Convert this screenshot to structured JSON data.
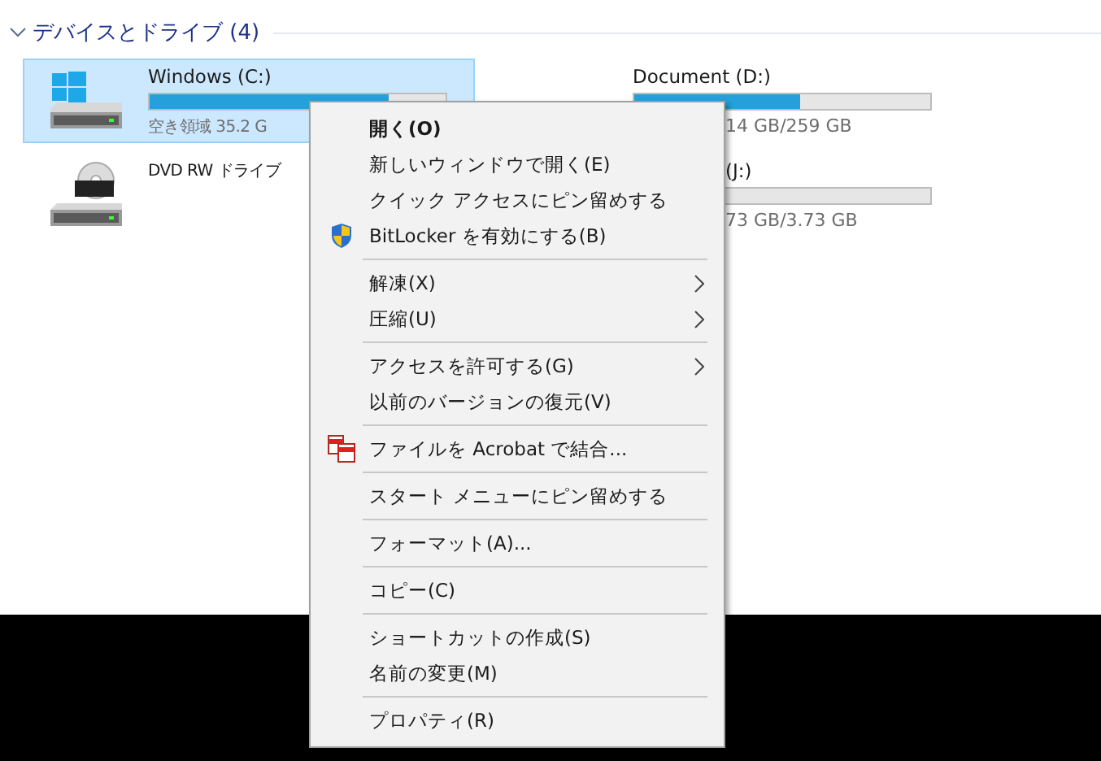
{
  "section": {
    "title": "デバイスとドライブ (4)",
    "expanded": true
  },
  "drives": [
    {
      "kind": "windows",
      "label": "Windows (C:)",
      "detail": "空き領域 35.2 G",
      "level": 0.81,
      "selected": true
    },
    {
      "kind": "plain",
      "label": "Document (D:)",
      "detail": "14 GB/259 GB",
      "level": 0.56,
      "selected": false
    },
    {
      "kind": "dvd",
      "label": "DVD RW ドライブ",
      "selected": false
    },
    {
      "kind": "covered",
      "label": "(J:)",
      "detail": "73 GB/3.73 GB",
      "selected": false
    }
  ],
  "context_menu": [
    {
      "kind": "item",
      "label": "開く(O)",
      "default": true
    },
    {
      "kind": "item",
      "label": "新しいウィンドウで開く(E)"
    },
    {
      "kind": "item",
      "label": "クイック アクセスにピン留めする"
    },
    {
      "kind": "shield",
      "label": "BitLocker を有効にする(B)"
    },
    {
      "kind": "separator"
    },
    {
      "kind": "item",
      "label": "解凍(X)",
      "submenu": true
    },
    {
      "kind": "item",
      "label": "圧縮(U)",
      "submenu": true
    },
    {
      "kind": "separator"
    },
    {
      "kind": "item",
      "label": "アクセスを許可する(G)",
      "submenu": true
    },
    {
      "kind": "item",
      "label": "以前のバージョンの復元(V)"
    },
    {
      "kind": "separator"
    },
    {
      "kind": "acrobat",
      "label": "ファイルを Acrobat で結合..."
    },
    {
      "kind": "separator"
    },
    {
      "kind": "item",
      "label": "スタート メニューにピン留めする"
    },
    {
      "kind": "separator"
    },
    {
      "kind": "item",
      "label": "フォーマット(A)..."
    },
    {
      "kind": "separator"
    },
    {
      "kind": "item",
      "label": "コピー(C)"
    },
    {
      "kind": "separator"
    },
    {
      "kind": "item",
      "label": "ショートカットの作成(S)"
    },
    {
      "kind": "item",
      "label": "名前の変更(M)"
    },
    {
      "kind": "separator"
    },
    {
      "kind": "item",
      "label": "プロパティ(R)"
    }
  ]
}
